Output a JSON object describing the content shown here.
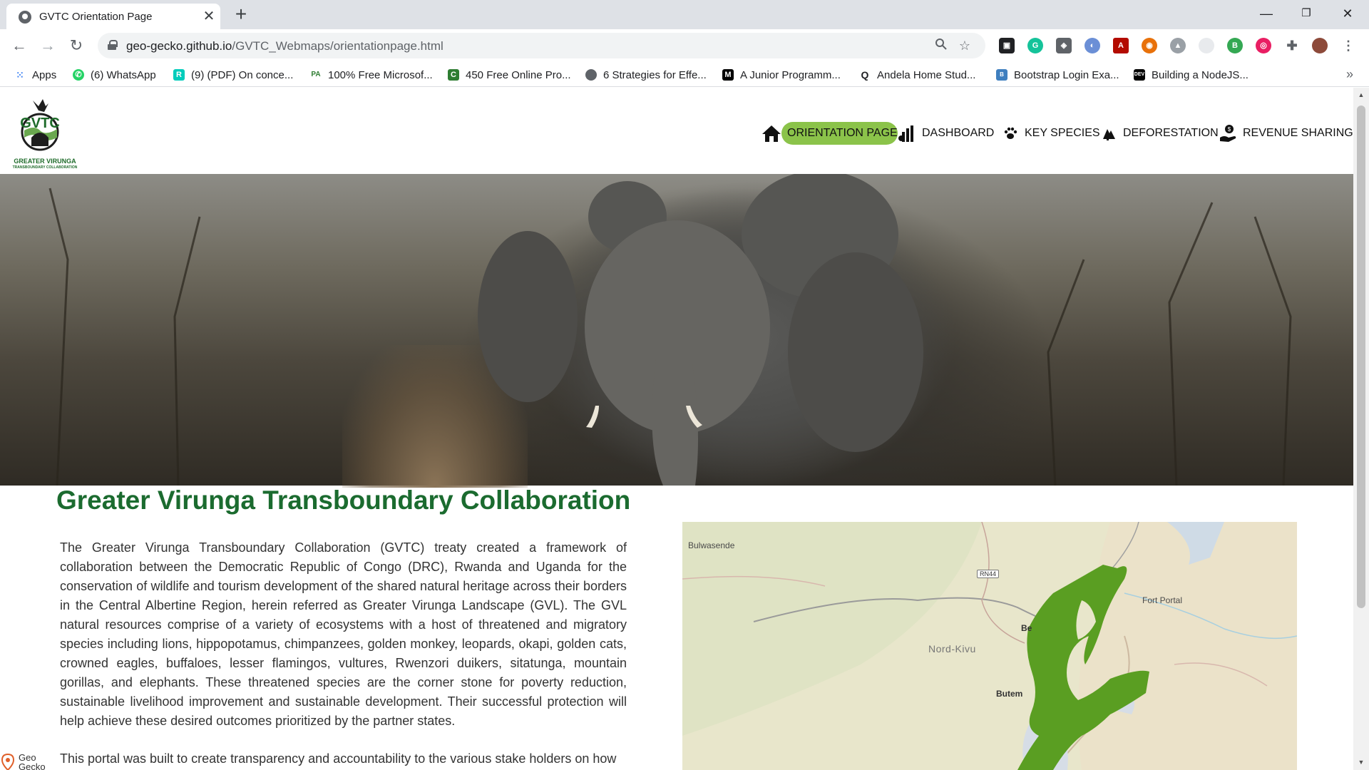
{
  "browser": {
    "tab_title": "GVTC Orientation Page",
    "url_host": "geo-gecko.github.io",
    "url_path": "/GVTC_Webmaps/orientationpage.html",
    "bookmarks": [
      {
        "label": "Apps",
        "icon": "apps-grid-icon",
        "color": "#4285f4"
      },
      {
        "label": "(6) WhatsApp",
        "icon": "whatsapp-icon",
        "color": "#25d366"
      },
      {
        "label": "(9) (PDF) On conce...",
        "icon": "researchgate-icon",
        "color": "#00ccbb"
      },
      {
        "label": "100% Free Microsof...",
        "icon": "pa-icon",
        "color": "#2e7d32"
      },
      {
        "label": "450 Free Online Pro...",
        "icon": "class-central-icon",
        "color": "#2e7d32"
      },
      {
        "label": "6 Strategies for Effe...",
        "icon": "globe-icon",
        "color": "#5f6368"
      },
      {
        "label": "A Junior Programm...",
        "icon": "medium-icon",
        "color": "#000000"
      },
      {
        "label": "Andela Home Stud...",
        "icon": "andela-icon",
        "color": "#202124"
      },
      {
        "label": "Bootstrap Login Exa...",
        "icon": "bootstrap-icon",
        "color": "#3f7fbf"
      },
      {
        "label": "Building a NodeJS...",
        "icon": "dev-icon",
        "color": "#000000"
      }
    ]
  },
  "site": {
    "logo_text": "GREATER VIRUNGA",
    "logo_sub": "TRANSBOUNDARY COLLABORATION",
    "logo_mark": "GVTC",
    "nav": [
      {
        "label": "ORIENTATION PAGE",
        "icon": "home-icon",
        "active": true
      },
      {
        "label": "DASHBOARD",
        "icon": "dashboard-icon"
      },
      {
        "label": "KEY SPECIES",
        "icon": "paw-icon"
      },
      {
        "label": "DEFORESTATION",
        "icon": "tree-cutting-icon"
      },
      {
        "label": "REVENUE SHARING",
        "icon": "hand-money-icon"
      }
    ],
    "accent_color": "#8bc34a",
    "heading_color": "#1b6b2f"
  },
  "content": {
    "heading": "Greater Virunga Transboundary Collaboration",
    "paragraph1": "The Greater Virunga Transboundary Collaboration (GVTC) treaty created a framework of collaboration between the Democratic Republic of Congo (DRC), Rwanda and Uganda for the conservation of wildlife and tourism development of the shared natural heritage across their borders in the Central Albertine Region, herein referred as Greater Virunga Landscape (GVL). The GVL natural resources comprise of a variety of ecosystems with a host of threatened and migratory species including lions, hippopotamus, chimpanzees, golden monkey, leopards, okapi, golden cats, crowned eagles, buffaloes, lesser flamingos, vultures, Rwenzori duikers, sitatunga, mountain gorillas, and elephants. These threatened species are the corner stone for poverty reduction, sustainable livelihood improvement and sustainable development. Their successful protection will help achieve these desired outcomes prioritized by the partner states.",
    "paragraph2": "This portal was built to create transparency and accountability to the various stake holders on how"
  },
  "map": {
    "labels": {
      "bulwasende": "Bulwasende",
      "fort_portal": "Fort Portal",
      "nord_kivu": "Nord-Kivu",
      "be": "Be",
      "butem": "Butem",
      "rn44": "RN44"
    }
  },
  "footer": {
    "badge_line1": "Geo",
    "badge_line2": "Gecko"
  }
}
